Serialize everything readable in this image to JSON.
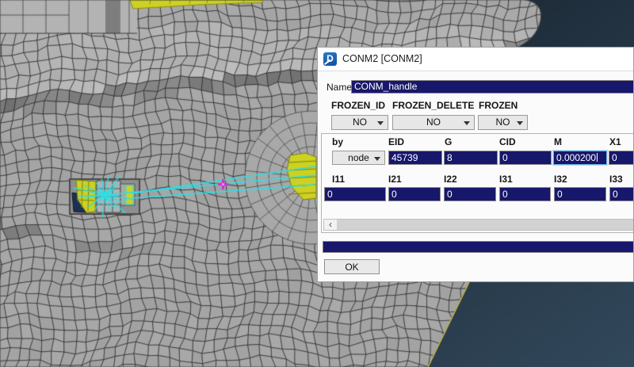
{
  "dialog": {
    "title": "CONM2 [CONM2]",
    "icon": "ansa-card-icon",
    "name_label": "Name",
    "name_value": "CONM_handle",
    "frozen": {
      "labels": [
        "FROZEN_ID",
        "FROZEN_DELETE",
        "FROZEN"
      ],
      "values": [
        "NO",
        "NO",
        "NO"
      ]
    },
    "table": {
      "headers_row1": [
        "by",
        "EID",
        "G",
        "CID",
        "M",
        "X1"
      ],
      "values_row1": [
        "node",
        "45739",
        "8",
        "0",
        "0.000200",
        "0"
      ],
      "headers_row2": [
        "I11",
        "I21",
        "I22",
        "I31",
        "I32",
        "I33"
      ],
      "values_row2": [
        "0",
        "0",
        "0",
        "0",
        "0",
        "0"
      ],
      "focused_field": "M"
    },
    "scrollbar": {
      "left_arrow": "‹"
    },
    "status_value": "",
    "ok_label": "OK",
    "colors": {
      "field_bg": "#17176b",
      "field_text": "#ffffff",
      "focus_border": "#6fb0d9"
    }
  },
  "viewport": {
    "elements": [
      "fe-quad-mesh",
      "rbe-spider-connector",
      "conm2-mass-marker",
      "highlighted-elements"
    ],
    "colors": {
      "background_top": "#18232e",
      "background_bottom": "#334a5d",
      "mesh_fill": "#a6a6a6",
      "mesh_line": "#2d2d2d",
      "highlight_yellow": "#cdd122",
      "connector_cyan": "#2ae0e8",
      "marker_magenta": "#cf2fcf",
      "element_navy": "#1d3054",
      "element_green": "#74ad3e",
      "free_edge_yellow": "#c9bd4a"
    }
  }
}
